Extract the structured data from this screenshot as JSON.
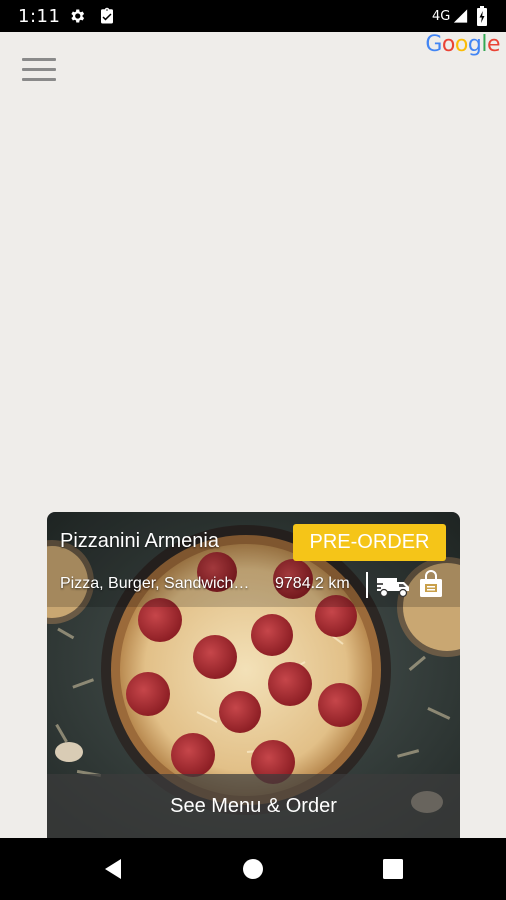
{
  "status_bar": {
    "time": "1:11",
    "network": "4G",
    "icons": [
      "settings-icon",
      "clipboard-check-icon",
      "signal-icon",
      "battery-icon"
    ]
  },
  "header": {
    "menu_icon": "hamburger-menu-icon",
    "logo_letters": [
      "G",
      "o",
      "o",
      "g",
      "l",
      "e"
    ]
  },
  "restaurant": {
    "name": "Pizzanini Armenia",
    "preorder_label": "PRE-ORDER",
    "cuisines": "Pizza, Burger, Sandwich…",
    "distance": "9784.2 km",
    "service_icons": [
      "delivery-truck-icon",
      "takeaway-bag-icon"
    ],
    "cta_label": "See Menu & Order"
  },
  "nav_bar": {
    "buttons": [
      "back-icon",
      "home-icon",
      "recents-icon"
    ]
  },
  "colors": {
    "background": "#efedea",
    "preorder": "#f5c518",
    "menu_icon": "#8a8a8a"
  }
}
